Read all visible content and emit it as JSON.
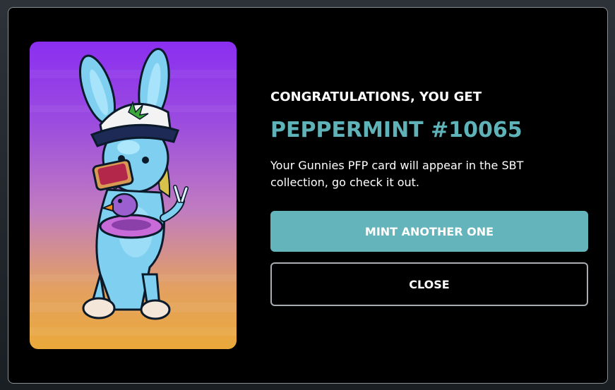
{
  "modal": {
    "heading": "CONGRATULATIONS, YOU GET",
    "item_name": "PEPPERMINT #10065",
    "description": "Your Gunnies PFP card will appear in the SBT collection, go check it out.",
    "primary_button": "MINT ANOTHER ONE",
    "secondary_button": "CLOSE",
    "colors": {
      "accent": "#63b5bb",
      "title": "#5fb3b8",
      "background": "#000000"
    }
  }
}
